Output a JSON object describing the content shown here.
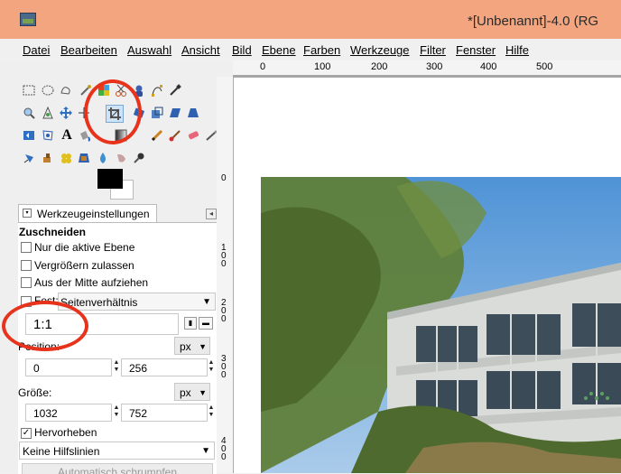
{
  "window": {
    "title": "*[Unbenannt]-4.0 (RG"
  },
  "menu": [
    "Datei",
    "Bearbeiten",
    "Auswahl",
    "Ansicht",
    "Bild",
    "Ebene",
    "Farben",
    "Werkzeuge",
    "Filter",
    "Fenster",
    "Hilfe"
  ],
  "toolbox": {
    "tools": [
      "rect-select-icon",
      "ellipse-select-icon",
      "free-select-icon",
      "fuzzy-select-icon",
      "color-select-icon",
      "scissors-icon",
      "foreground-select-icon",
      "paths-icon",
      "color-picker-icon",
      "zoom-icon",
      "measure-icon",
      "move-icon",
      "align-icon",
      "crop-icon",
      "rotate-icon",
      "scale-icon",
      "shear-icon",
      "perspective-icon",
      "flip-icon",
      "cage-icon",
      "text-icon",
      "bucket-fill-icon",
      "blend-icon",
      "pencil-icon",
      "paintbrush-icon",
      "eraser-icon",
      "airbrush-icon",
      "ink-icon",
      "clone-icon",
      "heal-icon",
      "perspective-clone-icon",
      "blur-icon",
      "smudge-icon",
      "dodge-icon"
    ],
    "fg_color": "#000000",
    "bg_color": "#ffffff"
  },
  "options": {
    "tab_label": "Werkzeugeinstellungen",
    "section_title": "Zuschneiden",
    "checkboxes": [
      {
        "label": "Nur die aktive Ebene",
        "checked": false
      },
      {
        "label": "Vergrößern zulassen",
        "checked": false
      },
      {
        "label": "Aus der Mitte aufziehen",
        "checked": false
      }
    ],
    "fixed_label": "Fest:",
    "fixed_dropdown": "Seitenverhältnis",
    "ratio_value": "1:1",
    "position_label": "Position:",
    "position_unit": "px",
    "position_x": "0",
    "position_y": "256",
    "size_label": "Größe:",
    "size_unit": "px",
    "size_w": "1032",
    "size_h": "752",
    "highlight_label": "Hervorheben",
    "highlight_checked": true,
    "guides_dropdown": "Keine Hilfslinien",
    "auto_shrink_label": "Automatisch schrumpfen"
  },
  "ruler": {
    "top_labels": [
      "0",
      "100",
      "200",
      "300",
      "400",
      "500"
    ],
    "left_labels": [
      "0",
      "100",
      "200",
      "300",
      "400"
    ]
  },
  "colors": {
    "titlebar": "#f2a57f",
    "annotation": "#e8331c"
  }
}
